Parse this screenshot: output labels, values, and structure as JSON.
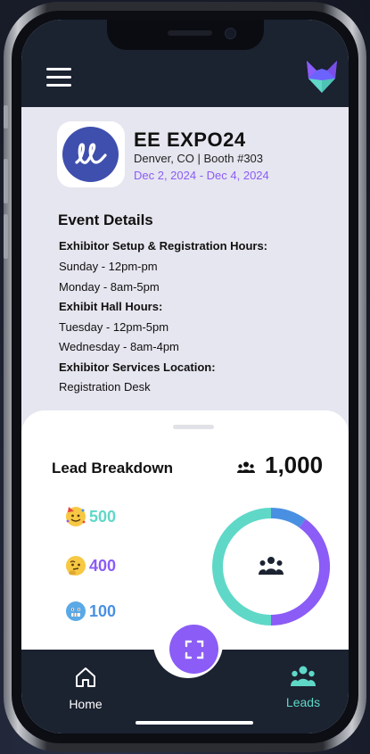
{
  "header": {
    "menu_icon": "hamburger-menu-icon",
    "logo_icon": "fox-logo-icon"
  },
  "event": {
    "name": "EE EXPO24",
    "location": "Denver, CO  | Booth #303",
    "dates": "Dec 2, 2024 - Dec 4, 2024",
    "logo_icon": "ll-script-logo-icon"
  },
  "details": {
    "title": "Event Details",
    "lines": [
      {
        "text": "Exhibitor Setup & Registration Hours:",
        "bold": true
      },
      {
        "text": "Sunday - 12pm-pm",
        "bold": false
      },
      {
        "text": "Monday - 8am-5pm",
        "bold": false
      },
      {
        "text": "Exhibit Hall Hours:",
        "bold": true
      },
      {
        "text": "Tuesday - 12pm-5pm",
        "bold": false
      },
      {
        "text": "Wednesday - 8am-4pm",
        "bold": false
      },
      {
        "text": "Exhibitor Services Location:",
        "bold": true
      },
      {
        "text": "Registration Desk",
        "bold": false
      }
    ]
  },
  "lead_breakdown": {
    "title": "Lead Breakdown",
    "total": "1,000",
    "stats": [
      {
        "emoji": "party-face-emoji",
        "value": "500",
        "color": "#5fd8c8"
      },
      {
        "emoji": "thinking-face-emoji",
        "value": "400",
        "color": "#8b5cf6"
      },
      {
        "emoji": "cold-face-emoji",
        "value": "100",
        "color": "#4a90e2"
      }
    ],
    "donut_center_icon": "users-group-icon"
  },
  "chart_data": {
    "type": "pie",
    "categories": [
      "party",
      "thinking",
      "cold"
    ],
    "values": [
      500,
      400,
      100
    ],
    "colors": [
      "#5fd8c8",
      "#8b5cf6",
      "#4a90e2"
    ]
  },
  "nav": {
    "home_label": "Home",
    "leads_label": "Leads",
    "scan_icon": "scan-icon",
    "home_icon": "home-icon",
    "leads_icon": "users-group-icon",
    "active_color": "#5fd8c8"
  }
}
